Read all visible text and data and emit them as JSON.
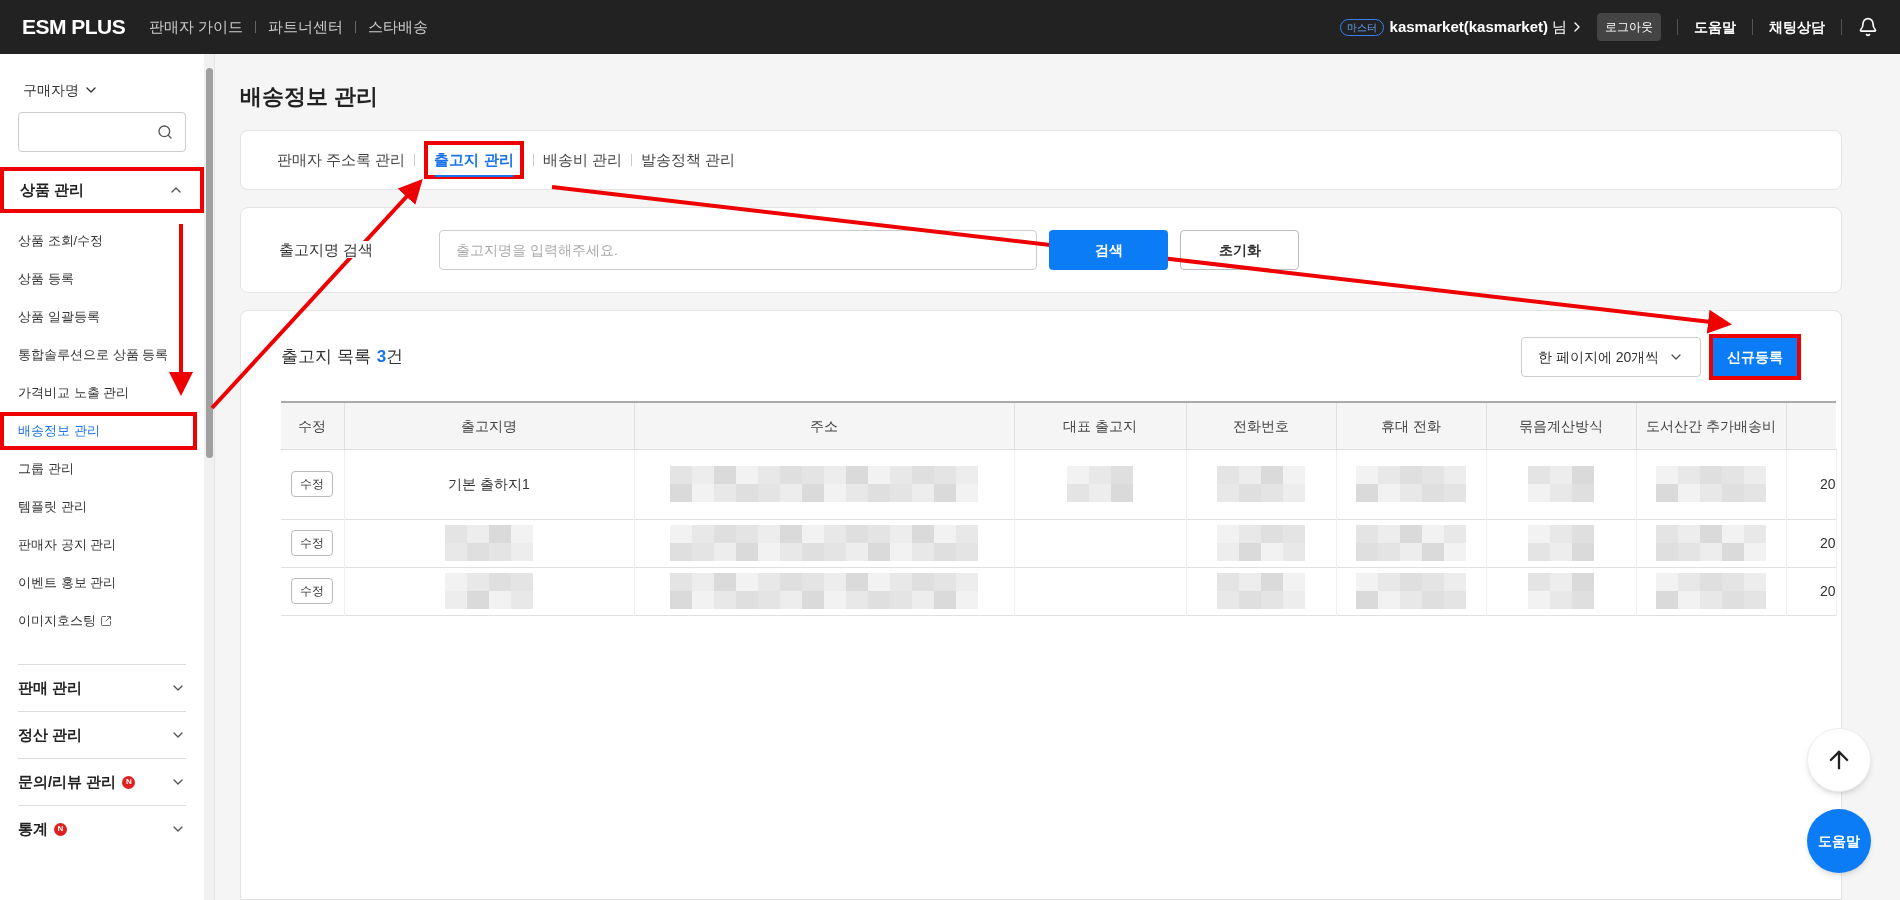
{
  "top_bar": {
    "logo": "ESM PLUS",
    "links": [
      "판매자 가이드",
      "파트너센터",
      "스타배송"
    ],
    "user_badge": "마스터",
    "user_name": "kasmarket(kasmarket)",
    "user_suffix": "님",
    "logout": "로그아웃",
    "help": "도움말",
    "chat": "채팅상담"
  },
  "sidebar": {
    "search_type": "구매자명",
    "sections": [
      {
        "label": "상품 관리",
        "expanded": true,
        "highlighted": true,
        "children": [
          {
            "label": "상품 조회/수정",
            "selected": false,
            "highlighted": false,
            "external": false
          },
          {
            "label": "상품 등록",
            "selected": false,
            "highlighted": false,
            "external": false
          },
          {
            "label": "상품 일괄등록",
            "selected": false,
            "highlighted": false,
            "external": false
          },
          {
            "label": "통합솔루션으로 상품 등록",
            "selected": false,
            "highlighted": false,
            "external": false
          },
          {
            "label": "가격비교 노출 관리",
            "selected": false,
            "highlighted": false,
            "external": false
          },
          {
            "label": "배송정보 관리",
            "selected": true,
            "highlighted": true,
            "external": false
          },
          {
            "label": "그룹 관리",
            "selected": false,
            "highlighted": false,
            "external": false
          },
          {
            "label": "템플릿 관리",
            "selected": false,
            "highlighted": false,
            "external": false
          },
          {
            "label": "판매자 공지 관리",
            "selected": false,
            "highlighted": false,
            "external": false
          },
          {
            "label": "이벤트 홍보 관리",
            "selected": false,
            "highlighted": false,
            "external": false
          },
          {
            "label": "이미지호스팅",
            "selected": false,
            "highlighted": false,
            "external": true
          }
        ]
      },
      {
        "label": "판매 관리",
        "expanded": false,
        "highlighted": false
      },
      {
        "label": "정산 관리",
        "expanded": false,
        "highlighted": false
      },
      {
        "label": "문의/리뷰 관리",
        "expanded": false,
        "highlighted": false,
        "badge": "N"
      },
      {
        "label": "통계",
        "expanded": false,
        "highlighted": false,
        "badge": "N"
      }
    ]
  },
  "page_title": "배송정보 관리",
  "tabs": [
    {
      "label": "판매자 주소록 관리",
      "selected": false,
      "highlighted": false
    },
    {
      "label": "출고지 관리",
      "selected": true,
      "highlighted": true
    },
    {
      "label": "배송비 관리",
      "selected": false,
      "highlighted": false
    },
    {
      "label": "발송정책 관리",
      "selected": false,
      "highlighted": false
    }
  ],
  "search": {
    "label": "출고지명 검색",
    "placeholder": "출고지명을 입력해주세요.",
    "search_button": "검색",
    "reset_button": "초기화"
  },
  "list": {
    "title": "출고지 목록",
    "count": "3",
    "count_suffix": "건",
    "page_size": "한 페이지에 20개씩",
    "new_button": {
      "label": "신규등록",
      "highlighted": true
    }
  },
  "table": {
    "columns": [
      "수정",
      "출고지명",
      "주소",
      "대표 출고지",
      "전화번호",
      "휴대 전화",
      "묶음계산방식",
      "도서산간 추가배송비",
      ""
    ],
    "rows": [
      {
        "cells": [
          {
            "kind": "button",
            "text": "수정"
          },
          {
            "kind": "text",
            "text": "기본 출하지1"
          },
          {
            "kind": "redacted"
          },
          {
            "kind": "redacted"
          },
          {
            "kind": "redacted"
          },
          {
            "kind": "redacted"
          },
          {
            "kind": "redacted"
          },
          {
            "kind": "redacted"
          },
          {
            "kind": "text",
            "text": "20"
          }
        ]
      },
      {
        "cells": [
          {
            "kind": "button",
            "text": "수정"
          },
          {
            "kind": "redacted"
          },
          {
            "kind": "redacted"
          },
          {
            "kind": "empty"
          },
          {
            "kind": "redacted"
          },
          {
            "kind": "redacted"
          },
          {
            "kind": "redacted"
          },
          {
            "kind": "redacted"
          },
          {
            "kind": "text",
            "text": "20"
          }
        ]
      },
      {
        "cells": [
          {
            "kind": "button",
            "text": "수정"
          },
          {
            "kind": "redacted"
          },
          {
            "kind": "redacted"
          },
          {
            "kind": "empty"
          },
          {
            "kind": "redacted"
          },
          {
            "kind": "redacted"
          },
          {
            "kind": "redacted"
          },
          {
            "kind": "redacted"
          },
          {
            "kind": "text",
            "text": "20"
          }
        ]
      }
    ]
  },
  "floating": {
    "help": "도움말"
  }
}
